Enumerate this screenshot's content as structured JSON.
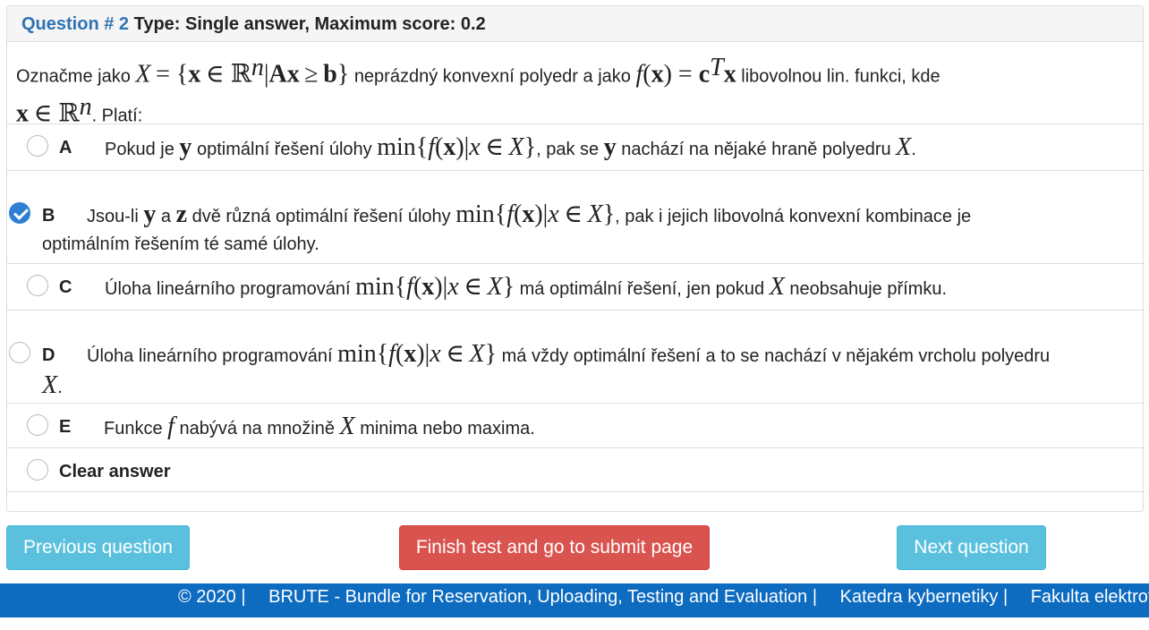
{
  "header": {
    "question_label": "Question # 2",
    "type_label": "Type: Single answer, Maximum score: 0.2"
  },
  "question": {
    "pre": "Označme jako",
    "mid": "neprázdný konvexní polyedr a jako",
    "post": "libovolnou lin. funkci, kde",
    "end": ". Platí:"
  },
  "options": [
    {
      "letter": "A",
      "selected": false,
      "t1": "Pokud je",
      "t2": "optimální řešení úlohy",
      "t3": ", pak se",
      "t4": "nachází na nějaké hraně polyedru"
    },
    {
      "letter": "B",
      "selected": true,
      "t1": "Jsou-li",
      "t2": "a",
      "t3": "dvě různá optimální řešení úlohy",
      "t4": ", pak i jejich libovolná konvexní kombinace je",
      "t5": "optimálním řešením té samé úlohy."
    },
    {
      "letter": "C",
      "selected": false,
      "t1": "Úloha lineárního programování",
      "t2": "má optimální řešení, jen pokud",
      "t3": "neobsahuje přímku."
    },
    {
      "letter": "D",
      "selected": false,
      "t1": "Úloha lineárního programování",
      "t2": "má vždy optimální řešení a to se nachází v nějakém vrcholu polyedru"
    },
    {
      "letter": "E",
      "selected": false,
      "t1": "Funkce",
      "t2": "nabývá na množině",
      "t3": "minima nebo maxima."
    }
  ],
  "clear_answer": "Clear answer",
  "buttons": {
    "previous": "Previous question",
    "finish": "Finish test and go to submit page",
    "next": "Next question"
  },
  "footer": {
    "copyright": "© 2020 |",
    "brute": "BRUTE - Bundle for Reservation, Uploading, Testing and Evaluation |",
    "dept": "Katedra kybernetiky |",
    "faculty": "Fakulta elektrotechnická"
  },
  "colors": {
    "accent_blue": "#2f73b3",
    "info": "#5bc0de",
    "danger": "#d9534f",
    "footer_bg": "#0d6bc0"
  }
}
